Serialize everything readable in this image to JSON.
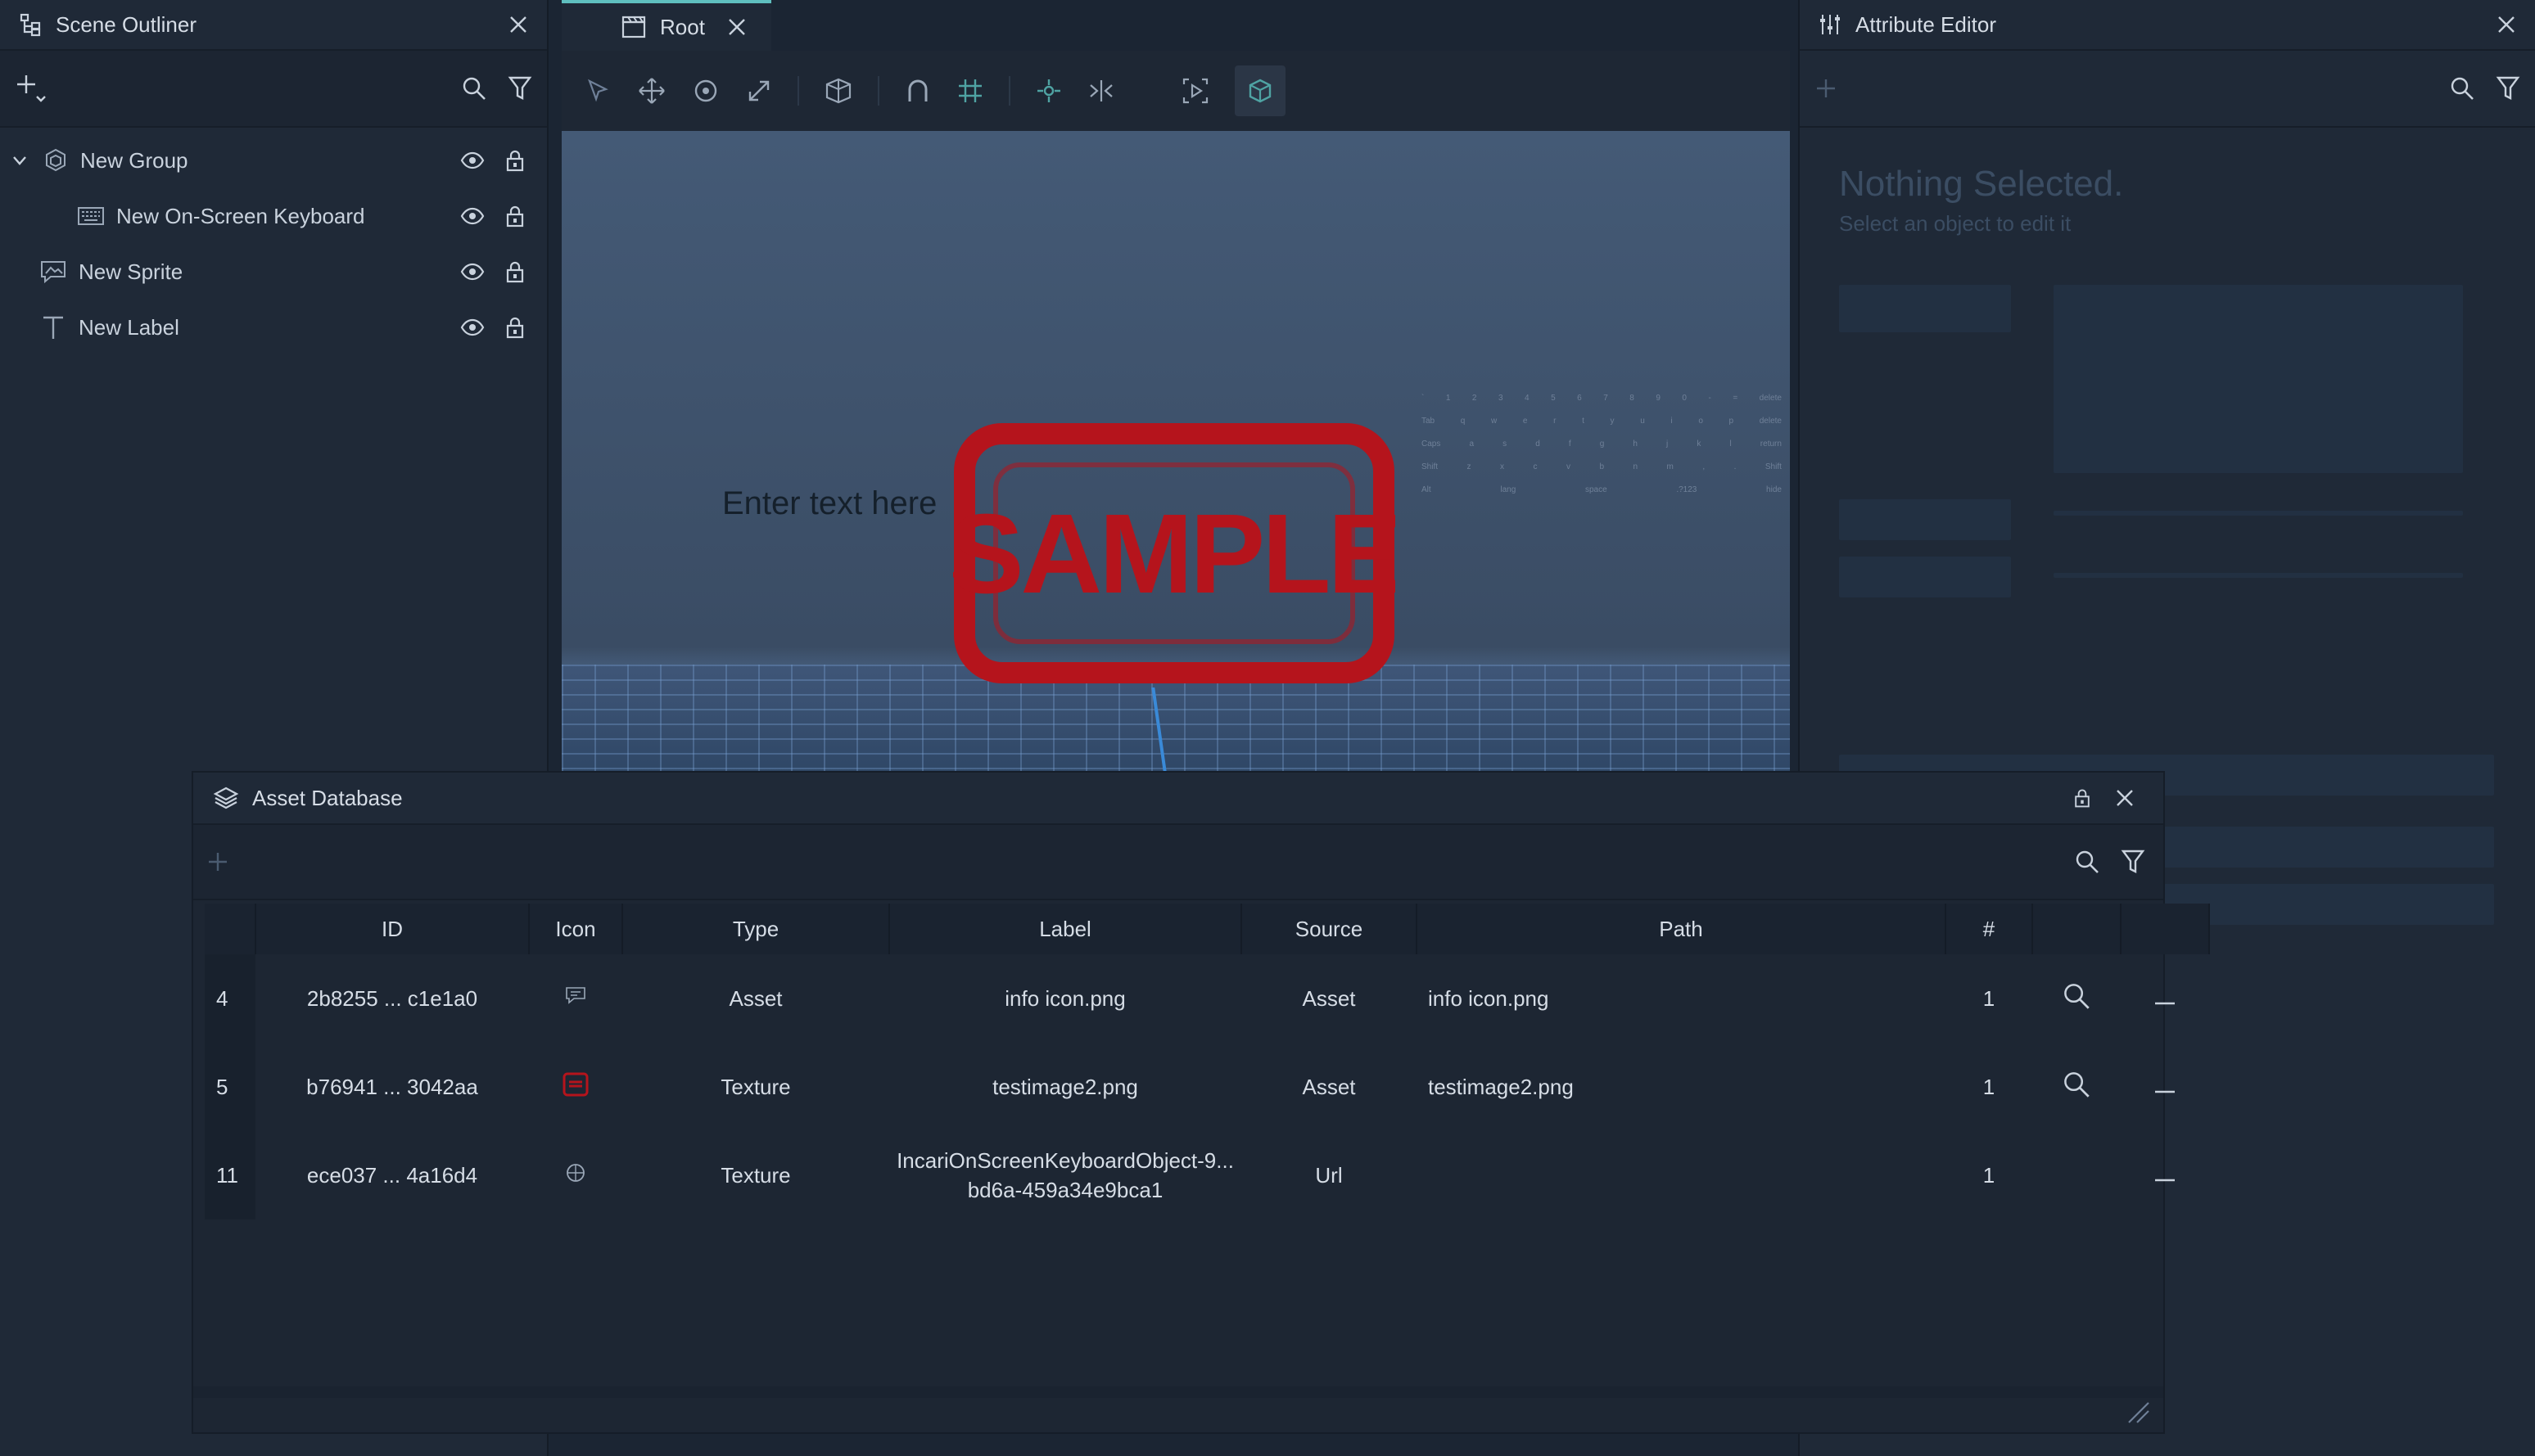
{
  "outliner": {
    "title": "Scene Outliner",
    "items": [
      {
        "label": "New Group"
      },
      {
        "label": "New On-Screen Keyboard"
      },
      {
        "label": "New Sprite"
      },
      {
        "label": "New Label"
      }
    ]
  },
  "viewport": {
    "tab_label": "Root",
    "label_text": "Enter text here",
    "sprite_text": "SAMPLE",
    "sprite_color": "#b5141c",
    "keyboard_rows": [
      [
        "`",
        "1",
        "2",
        "3",
        "4",
        "5",
        "6",
        "7",
        "8",
        "9",
        "0",
        "-",
        "=",
        "delete"
      ],
      [
        "Tab",
        "q",
        "w",
        "e",
        "r",
        "t",
        "y",
        "u",
        "i",
        "o",
        "p",
        "delete"
      ],
      [
        "Caps",
        "a",
        "s",
        "d",
        "f",
        "g",
        "h",
        "j",
        "k",
        "l",
        "return"
      ],
      [
        "Shift",
        "z",
        "x",
        "c",
        "v",
        "b",
        "n",
        "m",
        ",",
        ".",
        "Shift"
      ],
      [
        "Alt",
        "lang",
        "space",
        ".?123",
        "hide"
      ]
    ]
  },
  "attribute_editor": {
    "title": "Attribute Editor",
    "empty_title": "Nothing Selected.",
    "empty_subtitle": "Select an object to edit it"
  },
  "asset_db": {
    "title": "Asset Database",
    "columns": [
      "ID",
      "Icon",
      "Type",
      "Label",
      "Source",
      "Path",
      "#"
    ],
    "rows": [
      {
        "index": "4",
        "id": "2b8255 ... c1e1a0",
        "type": "Asset",
        "label": "info icon.png",
        "source": "Asset",
        "path": "info icon.png",
        "count": "1",
        "icon": "info-sprite-icon"
      },
      {
        "index": "5",
        "id": "b76941 ... 3042aa",
        "type": "Texture",
        "label": "testimage2.png",
        "source": "Asset",
        "path": "testimage2.png",
        "count": "1",
        "icon": "sample-texture-icon"
      },
      {
        "index": "11",
        "id": "ece037 ... 4a16d4",
        "type": "Texture",
        "label": "IncariOnScreenKeyboardObject-9... bd6a-459a34e9bca1",
        "label_line1": "IncariOnScreenKeyboardObject-9...",
        "label_line2": "bd6a-459a34e9bca1",
        "source": "Url",
        "path": "",
        "count": "1",
        "icon": "url-texture-icon"
      }
    ]
  },
  "colors": {
    "accent": "#5fbfbf",
    "panel": "#1f2937",
    "viewport_sky": "#445a76"
  }
}
